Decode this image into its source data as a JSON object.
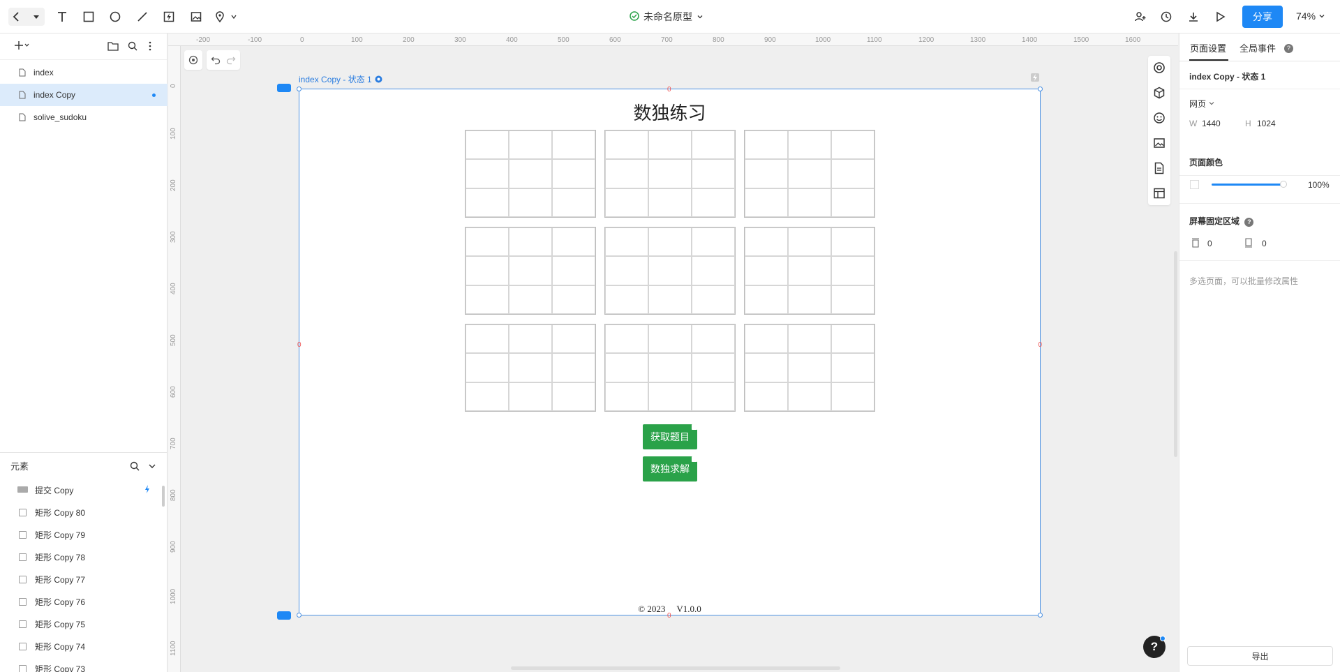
{
  "toolbar": {
    "doc_title": "未命名原型",
    "share_label": "分享",
    "zoom_label": "74%",
    "status_color": "#2aa249",
    "accent_color": "#1e88f5"
  },
  "pages": [
    {
      "label": "index"
    },
    {
      "label": "index Copy",
      "active": true
    },
    {
      "label": "solive_sudoku"
    }
  ],
  "elements_panel": {
    "title": "元素",
    "items": [
      {
        "label": "提交 Copy",
        "icon": "button-icon"
      },
      {
        "label": "矩形 Copy 80",
        "icon": "rect-icon"
      },
      {
        "label": "矩形 Copy 79",
        "icon": "rect-icon"
      },
      {
        "label": "矩形 Copy 78",
        "icon": "rect-icon"
      },
      {
        "label": "矩形 Copy 77",
        "icon": "rect-icon"
      },
      {
        "label": "矩形 Copy 76",
        "icon": "rect-icon"
      },
      {
        "label": "矩形 Copy 75",
        "icon": "rect-icon"
      },
      {
        "label": "矩形 Copy 74",
        "icon": "rect-icon"
      },
      {
        "label": "矩形 Copy 73",
        "icon": "rect-icon"
      }
    ]
  },
  "rulers": {
    "horizontal": [
      "-200",
      "-100",
      "0",
      "100",
      "200",
      "300",
      "400",
      "500",
      "600",
      "700",
      "800",
      "900",
      "1000",
      "1100",
      "1200",
      "1300",
      "1400",
      "1500",
      "1600"
    ],
    "vertical": [
      "0",
      "100",
      "200",
      "300",
      "400",
      "500",
      "600",
      "700",
      "800",
      "900",
      "1000",
      "1100"
    ]
  },
  "canvas": {
    "frame_label": "index Copy - 状态 1",
    "zero_marker": "0",
    "page_title": "数独练习",
    "button_get": "获取题目",
    "button_solve": "数独求解",
    "footer": "© 2023     V1.0.0",
    "button_color": "#2aa249"
  },
  "right_panel": {
    "tab_page_settings": "页面设置",
    "tab_global_events": "全局事件",
    "page_name": "index Copy - 状态 1",
    "device_type": "网页",
    "w_label": "W",
    "w_value": "1440",
    "h_label": "H",
    "h_value": "1024",
    "page_color_label": "页面颜色",
    "opacity_value": "100%",
    "fixed_area_label": "屏幕固定区域",
    "fixed_top_value": "0",
    "fixed_bottom_value": "0",
    "hint": "多选页面，可以批量修改属性",
    "export_label": "导出"
  }
}
